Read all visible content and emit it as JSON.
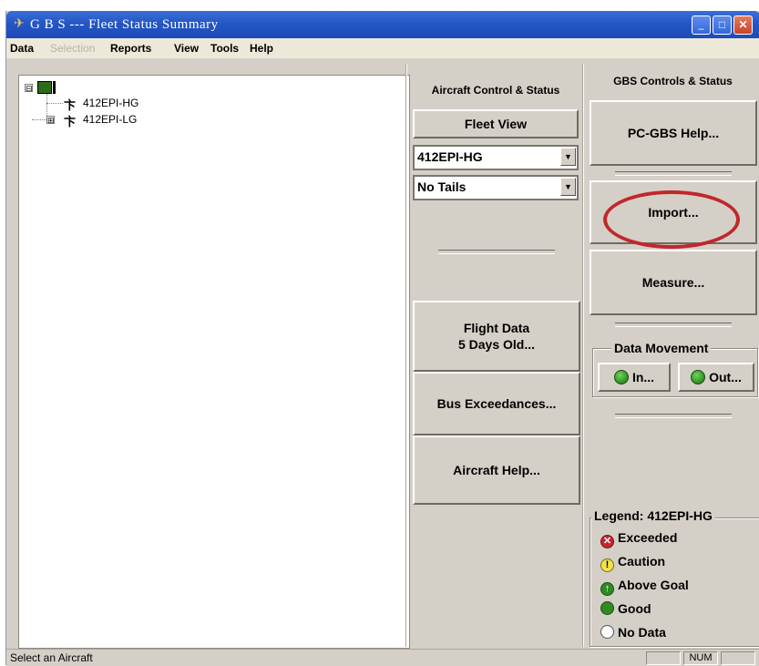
{
  "window": {
    "title": "G B S --- Fleet Status Summary",
    "buttons": {
      "minimize": "_",
      "maximize": "□",
      "close": "✕"
    }
  },
  "menu": [
    {
      "label": "Data",
      "enabled": true
    },
    {
      "label": "Selection",
      "enabled": false
    },
    {
      "label": "Reports",
      "enabled": true
    },
    {
      "label": "View",
      "enabled": true
    },
    {
      "label": "Tools",
      "enabled": true
    },
    {
      "label": "Help",
      "enabled": true
    }
  ],
  "tree": {
    "root_expander": "⊟",
    "items": [
      {
        "label": "412EPI-HG",
        "expander": ""
      },
      {
        "label": "412EPI-LG",
        "expander": "⊞"
      }
    ]
  },
  "aircraft_panel": {
    "title": "Aircraft Control & Status",
    "fleet_view": "Fleet View",
    "aircraft_select": "412EPI-HG",
    "tails_select": "No Tails",
    "flight_data_line1": "Flight Data",
    "flight_data_line2": "5 Days Old...",
    "bus_exceedances": "Bus Exceedances...",
    "aircraft_help": "Aircraft Help..."
  },
  "gbs_panel": {
    "title": "GBS Controls & Status",
    "pc_gbs_help": "PC-GBS Help...",
    "import": "Import...",
    "measure": "Measure...",
    "data_movement": {
      "label": "Data Movement",
      "in": "In...",
      "out": "Out..."
    }
  },
  "legend": {
    "title": "Legend: 412EPI-HG",
    "items": [
      {
        "label": "Exceeded",
        "icon": "exceeded-icon",
        "color": "#c1272d"
      },
      {
        "label": "Caution",
        "icon": "caution-icon",
        "color": "#f2e14a"
      },
      {
        "label": "Above Goal",
        "icon": "above-goal-icon",
        "color": "#2f8c22"
      },
      {
        "label": "Good",
        "icon": "good-icon",
        "color": "#2f8c22"
      },
      {
        "label": "No Data",
        "icon": "no-data-icon",
        "color": "#ffffff"
      }
    ]
  },
  "status": {
    "message": "Select an Aircraft",
    "num": "NUM"
  },
  "colors": {
    "titlebar": "#2456c6",
    "highlight": "#c1272d",
    "face": "#d4d0c8"
  }
}
